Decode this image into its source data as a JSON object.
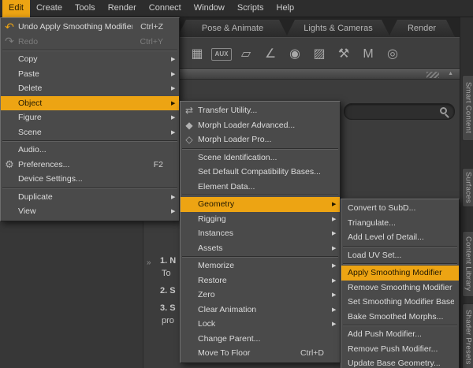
{
  "colors": {
    "accent": "#eda413",
    "accent_text": "#231a02",
    "menu_bg": "#4a4a4a",
    "window_bg": "#3c3c3c"
  },
  "menubar": {
    "items": [
      {
        "label": "Edit",
        "active": true
      },
      {
        "label": "Create"
      },
      {
        "label": "Tools"
      },
      {
        "label": "Render"
      },
      {
        "label": "Connect"
      },
      {
        "label": "Window"
      },
      {
        "label": "Scripts"
      },
      {
        "label": "Help"
      }
    ]
  },
  "workspace_tabs": [
    {
      "label": "Pose & Animate"
    },
    {
      "label": "Lights & Cameras"
    },
    {
      "label": "Render"
    }
  ],
  "side_tabs": [
    {
      "label": "Smart Content"
    },
    {
      "label": "Surfaces"
    },
    {
      "label": "Content Library"
    },
    {
      "label": "Shader Presets"
    }
  ],
  "toolbar": {
    "icons": [
      {
        "name": "scene-icon",
        "glyph": "▦"
      },
      {
        "name": "aux-viewport-icon",
        "glyph": "AUX",
        "text": true
      },
      {
        "name": "powerpose-icon",
        "glyph": "▱"
      },
      {
        "name": "joint-editor-icon",
        "glyph": "∠"
      },
      {
        "name": "camera-icon",
        "glyph": "◉"
      },
      {
        "name": "geometry-editor-icon",
        "glyph": "▨"
      },
      {
        "name": "tool-settings-icon",
        "glyph": "⚒"
      },
      {
        "name": "measure-metrics-icon",
        "glyph": "M"
      },
      {
        "name": "render-settings-icon",
        "glyph": "◎"
      }
    ]
  },
  "icon_glyphs": {
    "undo-icon": "↶",
    "redo-icon": "↷",
    "preferences-icon": "⚙",
    "transfer-utility-icon": "⇄",
    "morph-loader-advanced-icon": "◆",
    "morph-loader-pro-icon": "◇"
  },
  "menus": {
    "edit": {
      "items": [
        {
          "label": "Undo Apply Smoothing Modifier",
          "shortcut": "Ctrl+Z",
          "icon": "undo-icon"
        },
        {
          "label": "Redo",
          "shortcut": "Ctrl+Y",
          "icon": "redo-icon",
          "disabled": true,
          "sep": true
        },
        {
          "label": "Copy",
          "submenu": true
        },
        {
          "label": "Paste",
          "submenu": true
        },
        {
          "label": "Delete",
          "submenu": true
        },
        {
          "label": "Object",
          "submenu": true,
          "highlighted": true
        },
        {
          "label": "Figure",
          "submenu": true
        },
        {
          "label": "Scene",
          "submenu": true,
          "sep": true
        },
        {
          "label": "Audio..."
        },
        {
          "label": "Preferences...",
          "shortcut": "F2",
          "icon": "preferences-icon"
        },
        {
          "label": "Device Settings...",
          "sep": true
        },
        {
          "label": "Duplicate",
          "submenu": true
        },
        {
          "label": "View",
          "submenu": true
        }
      ]
    },
    "object": {
      "items": [
        {
          "label": "Transfer Utility...",
          "icon": "transfer-utility-icon"
        },
        {
          "label": "Morph Loader Advanced...",
          "icon": "morph-loader-advanced-icon"
        },
        {
          "label": "Morph Loader Pro...",
          "icon": "morph-loader-pro-icon",
          "sep": true
        },
        {
          "label": "Scene Identification..."
        },
        {
          "label": "Set Default Compatibility Bases..."
        },
        {
          "label": "Element Data...",
          "sep": true
        },
        {
          "label": "Geometry",
          "submenu": true,
          "highlighted": true
        },
        {
          "label": "Rigging",
          "submenu": true
        },
        {
          "label": "Instances",
          "submenu": true
        },
        {
          "label": "Assets",
          "submenu": true,
          "sep": true
        },
        {
          "label": "Memorize",
          "submenu": true
        },
        {
          "label": "Restore",
          "submenu": true
        },
        {
          "label": "Zero",
          "submenu": true
        },
        {
          "label": "Clear Animation",
          "submenu": true
        },
        {
          "label": "Lock",
          "submenu": true
        },
        {
          "label": "Change Parent..."
        },
        {
          "label": "Move To Floor",
          "shortcut": "Ctrl+D"
        }
      ]
    },
    "geometry": {
      "items": [
        {
          "label": "Convert to SubD..."
        },
        {
          "label": "Triangulate..."
        },
        {
          "label": "Add Level of Detail...",
          "sep": true
        },
        {
          "label": "Load UV Set...",
          "sep": true
        },
        {
          "label": "Apply Smoothing Modifier",
          "highlighted": true
        },
        {
          "label": "Remove Smoothing Modifier"
        },
        {
          "label": "Set Smoothing Modifier Base"
        },
        {
          "label": "Bake Smoothed Morphs...",
          "sep": true
        },
        {
          "label": "Add Push Modifier..."
        },
        {
          "label": "Remove Push Modifier..."
        },
        {
          "label": "Update Base Geometry..."
        }
      ]
    }
  },
  "background_fragments": [
    "»",
    "1. N",
    "To",
    "2. S",
    "3. S",
    "pro"
  ]
}
